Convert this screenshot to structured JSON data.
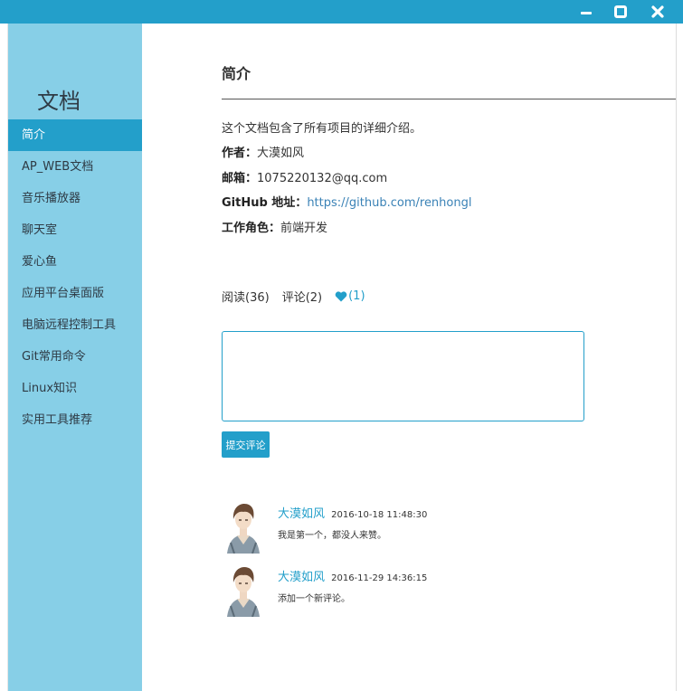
{
  "window": {
    "controls": {
      "minimize": "minimize-icon",
      "maximize": "maximize-icon",
      "close": "close-icon"
    },
    "accent": "#239fca"
  },
  "sidebar": {
    "title": "文档",
    "background": "#87cfe7",
    "items": [
      {
        "label": "简介",
        "active": true
      },
      {
        "label": "AP_WEB文档",
        "active": false
      },
      {
        "label": "音乐播放器",
        "active": false
      },
      {
        "label": "聊天室",
        "active": false
      },
      {
        "label": "爱心鱼",
        "active": false
      },
      {
        "label": "应用平台桌面版",
        "active": false
      },
      {
        "label": "电脑远程控制工具",
        "active": false
      },
      {
        "label": "Git常用命令",
        "active": false
      },
      {
        "label": "Linux知识",
        "active": false
      },
      {
        "label": "实用工具推荐",
        "active": false
      }
    ]
  },
  "main": {
    "title": "简介",
    "description": "这个文档包含了所有项目的详细介绍。",
    "author": {
      "label": "作者：",
      "value": "大漠如风"
    },
    "email": {
      "label": "邮箱：",
      "value": "1075220132@qq.com"
    },
    "github": {
      "label": "GitHub 地址：",
      "value": "https://github.com/renhongl"
    },
    "role": {
      "label": "工作角色：",
      "value": "前端开发"
    },
    "stats": {
      "reads": "阅读(36)",
      "comments": "评论(2)",
      "likes": "(1)"
    },
    "comment_input": {
      "value": "",
      "placeholder": ""
    },
    "submit_label": "提交评论",
    "comments": [
      {
        "author": "大漠如风",
        "time": "2016-10-18 11:48:30",
        "text": "我是第一个，都没人来赞。"
      },
      {
        "author": "大漠如风",
        "time": "2016-11-29 14:36:15",
        "text": "添加一个新评论。"
      }
    ]
  }
}
